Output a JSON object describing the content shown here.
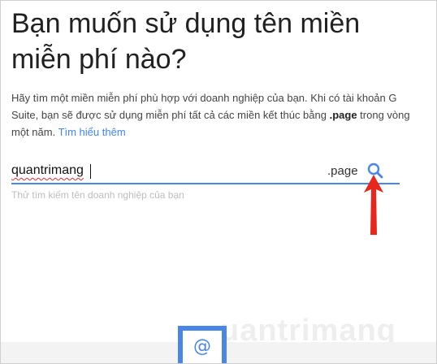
{
  "heading": "Bạn muốn sử dụng tên miền miễn phí nào?",
  "description": {
    "part1": "Hãy tìm một miền miễn phí phù hợp với doanh nghiệp của bạn. Khi có tài khoản G Suite, bạn sẽ được sử dụng miễn phí tất cả các miền kết thúc bằng ",
    "bold": ".page",
    "part2": " trong vòng một năm. ",
    "link": "Tìm hiểu thêm"
  },
  "search": {
    "value": "quantrimang",
    "tld": ".page",
    "hint": "Thử tìm kiếm tên doanh nghiệp của bạn"
  },
  "bottom": {
    "at_symbol": "@"
  },
  "watermark": "uantrimang",
  "colors": {
    "accent": "#4a86e8",
    "arrow": "#e8261c",
    "link": "#4285f4"
  }
}
